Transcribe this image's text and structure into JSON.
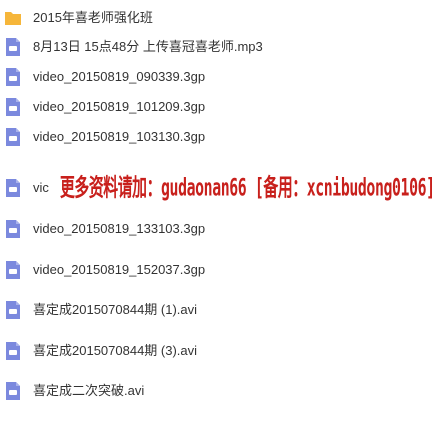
{
  "colors": {
    "folder": "#f6b63a",
    "file": "#7b89de",
    "text": "#333333",
    "watermark": "#c8201c"
  },
  "items": [
    {
      "name": "2015年喜老师强化班",
      "icon": "folder-icon"
    },
    {
      "name": "8月13日 15点48分 上传喜冠喜老师.mp3",
      "icon": "audio-file-icon"
    },
    {
      "name": "video_20150819_090339.3gp",
      "icon": "video-file-icon"
    },
    {
      "name": "video_20150819_101209.3gp",
      "icon": "video-file-icon"
    },
    {
      "name": "video_20150819_103130.3gp",
      "icon": "video-file-icon"
    },
    {
      "name": "vic",
      "icon": "video-file-icon"
    },
    {
      "name": "video_20150819_133103.3gp",
      "icon": "video-file-icon"
    },
    {
      "name": "video_20150819_152037.3gp",
      "icon": "video-file-icon"
    },
    {
      "name": "喜定成2015070844期 (1).avi",
      "icon": "video-file-icon"
    },
    {
      "name": "喜定成2015070844期 (3).avi",
      "icon": "video-file-icon"
    },
    {
      "name": "喜定成二次突破.avi",
      "icon": "video-file-icon"
    }
  ],
  "watermark": "更多资料请加：gudaonan66 [备用：xcnibudong0106]"
}
